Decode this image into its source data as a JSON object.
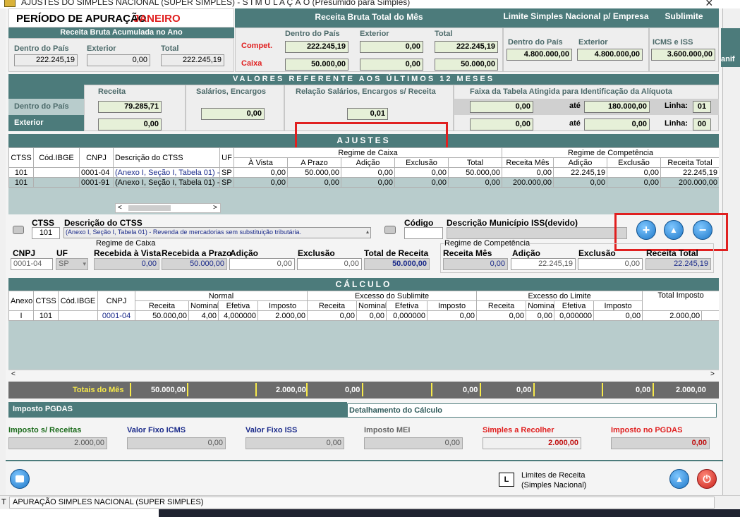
{
  "window": {
    "title": "AJUSTES DO SIMPLES NACIONAL (SUPER SIMPLES)   -   S I M U L A Ç Ã O (Presumido para Simples)",
    "close": "×"
  },
  "header": {
    "periodo_label": "PERÍODO DE APURAÇÃO:",
    "periodo_value": "JANEIRO",
    "receita_bruta_mes": "Receita Bruta Total do Mês",
    "limite": "Limite Simples Nacional p/ Empresa",
    "sublimite": "Sublimite"
  },
  "acumulada": {
    "title": "Receita Bruta Acumulada no Ano",
    "dentro_label": "Dentro do País",
    "exterior_label": "Exterior",
    "total_label": "Total",
    "dentro": "222.245,19",
    "exterior": "0,00",
    "total": "222.245,19"
  },
  "mes": {
    "dentro_label": "Dentro do País",
    "exterior_label": "Exterior",
    "total_label": "Total",
    "compet_label": "Compet.",
    "caixa_label": "Caixa",
    "compet_dentro": "222.245,19",
    "compet_exterior": "0,00",
    "compet_total": "222.245,19",
    "caixa_dentro": "50.000,00",
    "caixa_exterior": "0,00",
    "caixa_total": "50.000,00"
  },
  "limite": {
    "dentro_label": "Dentro do País",
    "exterior_label": "Exterior",
    "dentro": "4.800.000,00",
    "exterior": "4.800.000,00"
  },
  "sublimite": {
    "label": "ICMS e ISS",
    "value": "3.600.000,00"
  },
  "side_text": "anif",
  "ultimos": {
    "title": "VALORES REFERENTE AOS ÚLTIMOS 12 MESES",
    "receita": "Receita",
    "salarios": "Salários, Encargos",
    "relacao": "Relação Salários, Encargos s/ Receita",
    "faixa": "Faixa da Tabela Atingida para Identificação da Alíquota",
    "dentro_label": "Dentro do País",
    "exterior_label": "Exterior",
    "receita_dentro": "79.285,71",
    "receita_exterior": "0,00",
    "salarios_value": "0,00",
    "relacao_value": "0,01",
    "faixa1_de": "0,00",
    "faixa1_ate_label": "até",
    "faixa1_ate": "180.000,00",
    "linha_label": "Linha:",
    "linha1": "01",
    "faixa2_de": "0,00",
    "faixa2_ate_label": "até",
    "faixa2_ate": "0,00",
    "linha2": "00"
  },
  "ajustes": {
    "title": "AJUSTES",
    "col_ctss": "CTSS",
    "col_ibge": "Cód.IBGE",
    "col_cnpj": "CNPJ",
    "col_desc": "Descrição do CTSS",
    "col_uf": "UF",
    "regime_caixa": "Regime de Caixa",
    "regime_comp": "Regime de Competência",
    "col_avista": "À Vista",
    "col_aprazo": "A Prazo",
    "col_adicao": "Adição",
    "col_exclusao": "Exclusão",
    "col_total": "Total",
    "col_recmes": "Receita Mês",
    "col_adicao2": "Adição",
    "col_exclusao2": "Exclusão",
    "col_rectotal": "Receita Total",
    "rows": [
      {
        "ctss": "101",
        "ibge": "",
        "cnpj": "0001-04",
        "desc": "(Anexo I, Seção I, Tabela 01) -",
        "uf": "SP",
        "avista": "0,00",
        "aprazo": "50.000,00",
        "adicao": "0,00",
        "exclusao": "0,00",
        "total": "50.000,00",
        "recmes": "0,00",
        "adicao2": "22.245,19",
        "exclusao2": "0,00",
        "rectotal": "22.245,19"
      },
      {
        "ctss": "101",
        "ibge": "",
        "cnpj": "0001-91",
        "desc": "(Anexo I, Seção I, Tabela 01) -",
        "uf": "SP",
        "avista": "0,00",
        "aprazo": "0,00",
        "adicao": "0,00",
        "exclusao": "0,00",
        "total": "0,00",
        "recmes": "200.000,00",
        "adicao2": "0,00",
        "exclusao2": "0,00",
        "rectotal": "200.000,00"
      }
    ]
  },
  "form": {
    "ctss_label": "CTSS",
    "ctss_value": "101",
    "desc_label": "Descrição do CTSS",
    "desc_value": "(Anexo I, Seção I, Tabela 01) - Revenda de mercadorias sem substituição tributária.",
    "codigo_label": "Código",
    "municipio_label": "Descrição Município ISS(devido)",
    "cnpj_label": "CNPJ",
    "cnpj_value": "0001-04",
    "uf_label": "UF",
    "uf_value": "SP",
    "regime_caixa": "Regime de Caixa",
    "avista_label": "Recebida à Vista",
    "aprazo_label": "Recebida a Prazo",
    "adicao_label": "Adição",
    "exclusao_label": "Exclusão",
    "total_label": "Total de Receita",
    "avista": "0,00",
    "aprazo": "50.000,00",
    "adicao": "0,00",
    "exclusao": "0,00",
    "total": "50.000,00",
    "regime_comp": "Regime de Competência",
    "recmes_label": "Receita Mês",
    "adicao2_label": "Adição",
    "exclusao2_label": "Exclusão",
    "rectotal_label": "Receita Total",
    "recmes": "0,00",
    "adicao2": "22.245,19",
    "exclusao2": "0,00",
    "rectotal": "22.245,19"
  },
  "calculo": {
    "title": "CÁLCULO",
    "col_anexo": "Anexo",
    "col_ctss": "CTSS",
    "col_ibge": "Cód.IBGE",
    "col_cnpj": "CNPJ",
    "normal": "Normal",
    "excesso_sub": "Excesso do Sublimite",
    "excesso_lim": "Excesso do Limite",
    "total_imposto": "Total Imposto",
    "receita": "Receita",
    "nominal": "Nominal",
    "efetiva": "Efetiva",
    "imposto": "Imposto",
    "row": {
      "anexo": "I",
      "ctss": "101",
      "ibge": "",
      "cnpj": "0001-04",
      "n_receita": "50.000,00",
      "n_nominal": "4,00",
      "n_efetiva": "4,000000",
      "n_imposto": "2.000,00",
      "s_receita": "0,00",
      "s_nominal": "0,00",
      "s_efetiva": "0,000000",
      "s_imposto": "0,00",
      "l_receita": "0,00",
      "l_nominal": "0,00",
      "l_efetiva": "0,000000",
      "l_imposto": "0,00",
      "total": "2.000,00"
    },
    "totais_label": "Totais do Mês",
    "t_receita": "50.000,00",
    "t_imposto": "2.000,00",
    "t_s_receita": "0,00",
    "t_s_imposto": "0,00",
    "t_l_receita": "0,00",
    "t_l_imposto": "0,00",
    "t_total": "2.000,00"
  },
  "tabs": {
    "pgdas": "Imposto PGDAS",
    "detalhe": "Detalhamento do Cálculo"
  },
  "resumo": {
    "imposto_label": "Imposto s/ Receitas",
    "imposto": "2.000,00",
    "icms_label": "Valor Fixo ICMS",
    "icms": "0,00",
    "iss_label": "Valor Fixo ISS",
    "iss": "0,00",
    "mei_label": "Imposto MEI",
    "mei": "0,00",
    "recolher_label": "Simples a Recolher",
    "recolher": "2.000,00",
    "pgdas_label": "Imposto no PGDAS",
    "pgdas": "0,00"
  },
  "footer": {
    "l_key": "L",
    "limites_line1": "Limites de Receita",
    "limites_line2": "(Simples Nacional)"
  },
  "status": {
    "text": "APURAÇÃO SIMPLES NACIONAL (SUPER SIMPLES)",
    "prefix": "T"
  },
  "colors": {
    "teal": "#4c7b7b",
    "red": "#e02020",
    "blue": "#1f78c8"
  }
}
